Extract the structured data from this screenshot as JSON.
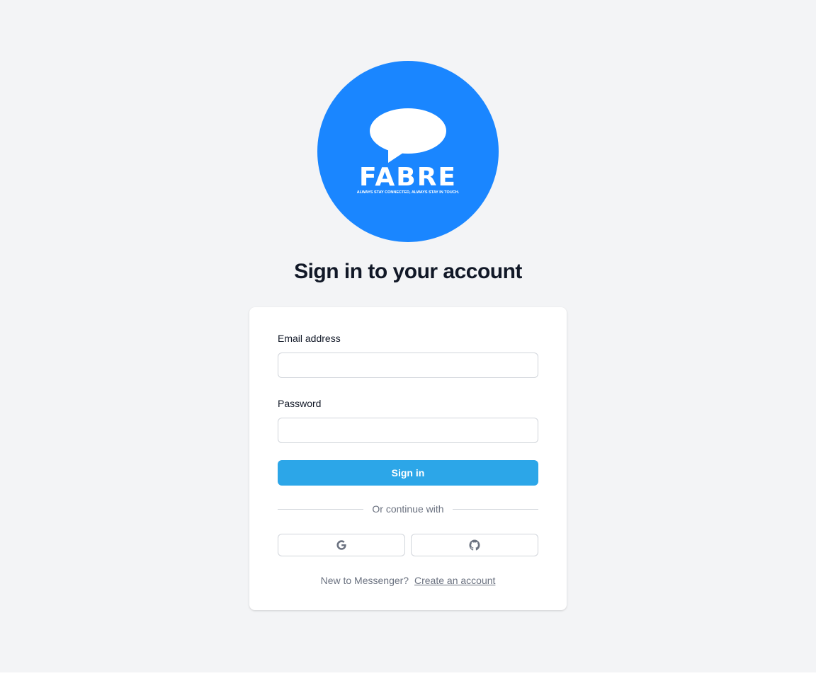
{
  "logo": {
    "brand": "FABRE",
    "tagline": "ALWAYS STAY CONNECTED, ALWAYS STAY IN TOUCH.",
    "icon": "speech-bubble-icon",
    "color": "#1a86ff"
  },
  "heading": "Sign in to your account",
  "form": {
    "email_label": "Email address",
    "email_value": "",
    "password_label": "Password",
    "password_value": "",
    "submit_label": "Sign in",
    "submit_color": "#2ca6e8"
  },
  "divider": "Or continue with",
  "social": [
    {
      "provider": "google",
      "icon": "google-icon"
    },
    {
      "provider": "github",
      "icon": "github-icon"
    }
  ],
  "footer": {
    "prompt": "New to Messenger?",
    "link": "Create an account"
  }
}
